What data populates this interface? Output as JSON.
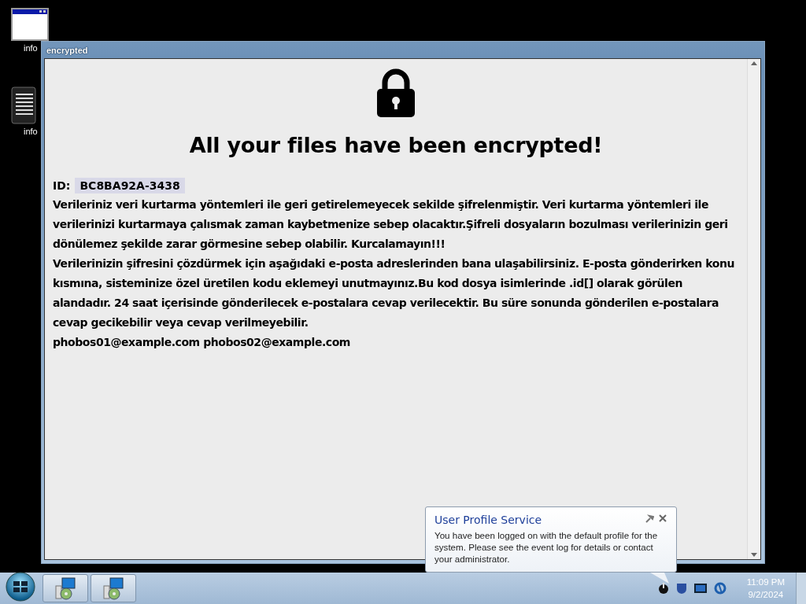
{
  "desktop_icons": [
    {
      "kind": "window",
      "label": "info"
    },
    {
      "kind": "document",
      "label": "info"
    }
  ],
  "window": {
    "title": "encrypted",
    "heading": "All your files have been encrypted!",
    "id_label": "ID:",
    "id_value": "BC8BA92A-3438",
    "paragraphs": [
      "Verileriniz veri kurtarma yöntemleri ile geri getirelemeyecek sekilde şifrelenmiştir. Veri kurtarma yöntemleri ile verilerinizi kurtarmaya çalısmak zaman kaybetmenize sebep olacaktır.Şifreli dosyaların bozulması verilerinizin geri dönülemez şekilde zarar görmesine sebep olabilir. Kurcalamayın!!!",
      "Verilerinizin şifresini çözdürmek için aşağıdaki e-posta adreslerinden bana ulaşabilirsiniz. E-posta gönderirken konu kısmına, sisteminize özel üretilen kodu eklemeyi unutmayınız.Bu kod dosya isimlerinde .id[] olarak görülen alandadır. 24 saat içerisinde gönderilecek e-postalara cevap verilecektir. Bu süre sonunda gönderilen e-postalara cevap gecikebilir veya cevap verilmeyebilir.",
      "phobos01@example.com phobos02@example.com"
    ]
  },
  "notification": {
    "title": "User Profile Service",
    "message": "You have been logged on with the default profile for the system. Please see the event log for details or contact your administrator."
  },
  "clock": {
    "time": "11:09 PM",
    "date": "9/2/2024"
  }
}
